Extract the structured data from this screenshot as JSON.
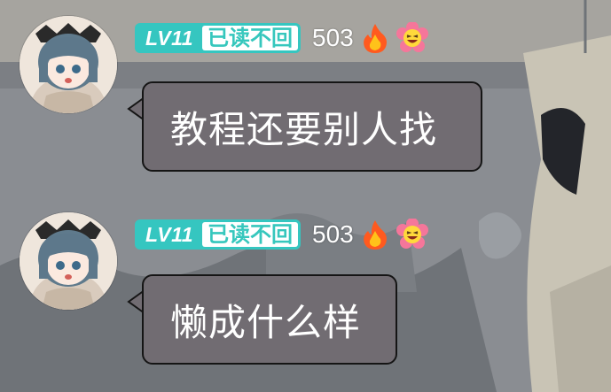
{
  "messages": [
    {
      "level": "LV11",
      "title": "已读不回",
      "count": "503",
      "icons": [
        "fire-icon",
        "smiley-flower-icon"
      ],
      "text": "教程还要别人找"
    },
    {
      "level": "LV11",
      "title": "已读不回",
      "count": "503",
      "icons": [
        "fire-icon",
        "smiley-flower-icon"
      ],
      "text": "懒成什么样"
    }
  ],
  "colors": {
    "badge": "#35c6c0",
    "bubble": "#716c72",
    "background": "#878a8e"
  }
}
